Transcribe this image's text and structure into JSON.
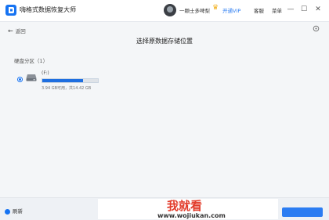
{
  "titlebar": {
    "app_title": "嗨格式数据恢复大师",
    "username": "一颗士多啤梨",
    "vip_label": "开通VIP",
    "menu": [
      "客服",
      "菜单"
    ],
    "controls": {
      "minimize": "—",
      "maximize": "☐",
      "close": "✕"
    }
  },
  "nav": {
    "back_arrow": "←",
    "back_label": "返回"
  },
  "page": {
    "title": "选择原数据存储位置",
    "section_label": "硬盘分区（1）"
  },
  "drives": [
    {
      "name": "(F:)",
      "size_text": "3.94 GB可用，共14.42 GB",
      "used_fraction": 0.73,
      "selected": true
    }
  ],
  "footer": {
    "refresh_label": "刷新"
  },
  "watermark": {
    "text_cn": "我就看",
    "text_url": "www.wojiukan.com"
  },
  "colors": {
    "accent": "#1673f2",
    "bar_fill": "#1f6fe0",
    "vip": "#2b7cf2",
    "crown": "#f2b01e",
    "watermark_red": "#e23b2a"
  },
  "icons": {
    "app": "app-logo-icon",
    "back": "arrow-left-icon",
    "drive": "hard-drive-icon",
    "refresh": "refresh-icon",
    "scope": "scope-icon"
  }
}
